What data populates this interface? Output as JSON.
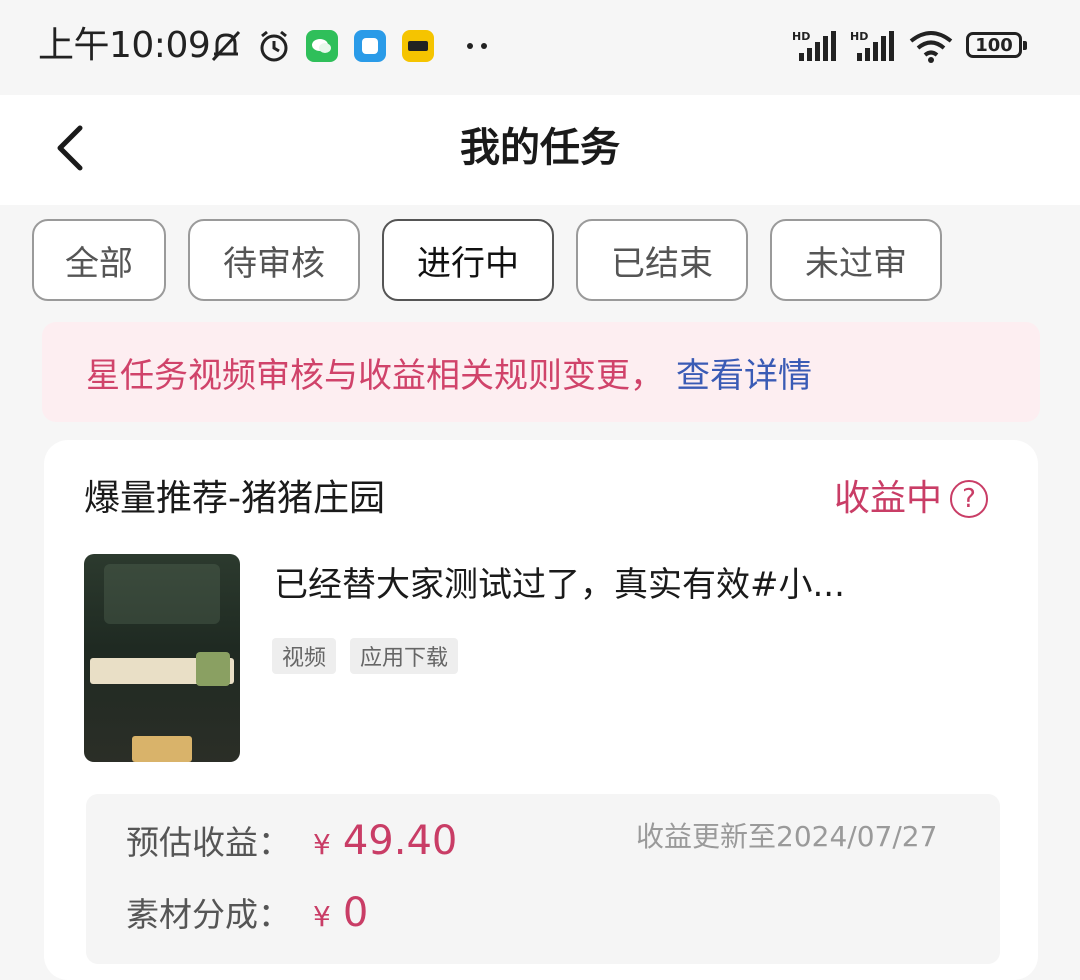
{
  "status_bar": {
    "time": "上午10:09",
    "battery": "100"
  },
  "header": {
    "title": "我的任务"
  },
  "tabs": [
    {
      "label": "全部"
    },
    {
      "label": "待审核"
    },
    {
      "label": "进行中"
    },
    {
      "label": "已结束"
    },
    {
      "label": "未过审"
    }
  ],
  "active_tab": "进行中",
  "notice": {
    "text": "星任务视频审核与收益相关规则变更，",
    "link": "查看详情"
  },
  "task": {
    "title": "爆量推荐-猪猪庄园",
    "status": "收益中",
    "help_symbol": "?",
    "video_title": "已经替大家测试过了，真实有效#小...",
    "tags": [
      "视频",
      "应用下载"
    ],
    "estimated_label": "预估收益：",
    "currency": "¥",
    "estimated_value": "49.40",
    "update_note": "收益更新至2024/07/27",
    "share_label": "素材分成：",
    "share_value": "0"
  },
  "colors": {
    "accent": "#c93d66",
    "link": "#3a5bb5",
    "notice_bg": "#fdeef1"
  }
}
